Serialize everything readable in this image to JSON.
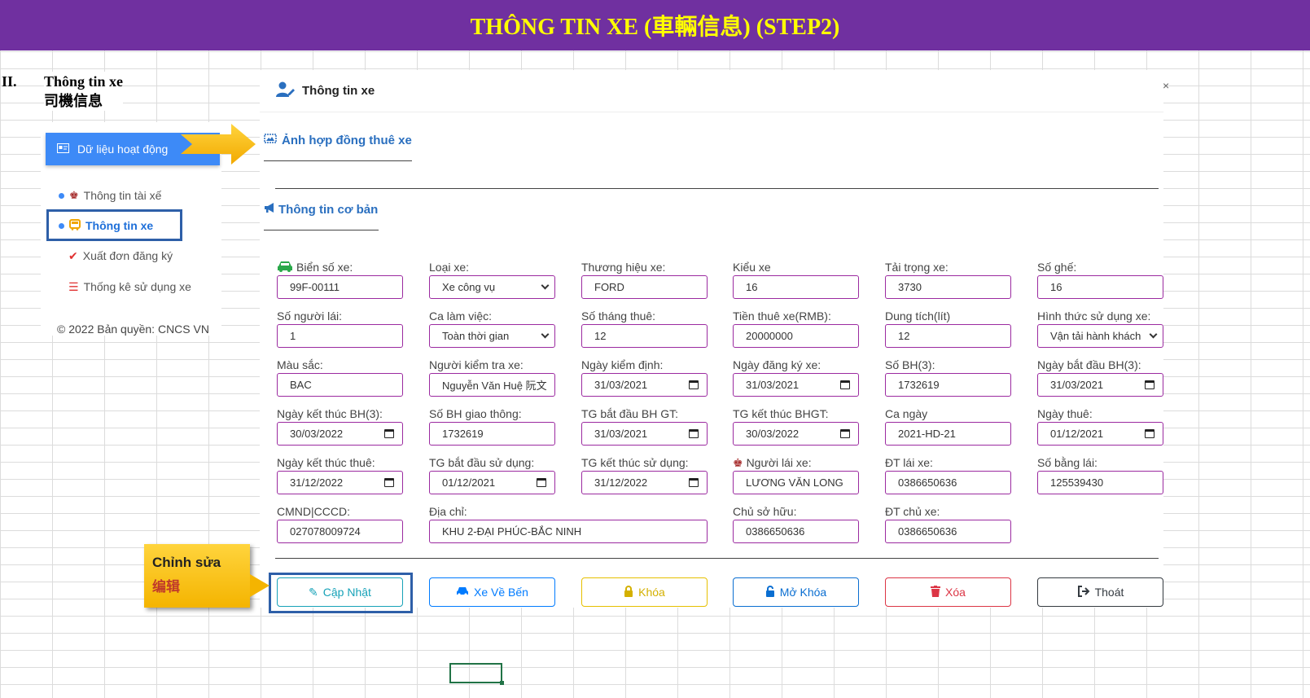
{
  "banner": {
    "title": "THÔNG TIN XE (車輛信息) (STEP2)"
  },
  "section": {
    "number": "II.",
    "title_vi": "Thông tin xe",
    "title_zh": "司機信息"
  },
  "sidebar": {
    "active_label": "Dữ liệu hoạt động",
    "items": [
      {
        "label": "Thông tin tài xế",
        "icon": "driver-icon",
        "active": false
      },
      {
        "label": "Thông tin xe",
        "icon": "bus-icon",
        "active": true
      },
      {
        "label": "Xuất đơn đăng ký",
        "icon": "check-icon",
        "active": false
      },
      {
        "label": "Thống kê sử dụng xe",
        "icon": "list-icon",
        "active": false
      }
    ],
    "copyright": "© 2022 Bản quyền: CNCS VN"
  },
  "modal": {
    "title": "Thông tin xe",
    "close": "×",
    "contract_link": "Ảnh hợp đồng thuê xe",
    "basic_info": "Thông tin cơ bản"
  },
  "fields": [
    {
      "label": "Biển số xe:",
      "value": "99F-00111",
      "type": "text"
    },
    {
      "label": "Loại xe:",
      "value": "Xe công vụ",
      "type": "select"
    },
    {
      "label": "Thương hiệu xe:",
      "value": "FORD",
      "type": "text"
    },
    {
      "label": "Kiểu xe",
      "value": "16",
      "type": "text"
    },
    {
      "label": "Tải trọng xe:",
      "value": "3730",
      "type": "text"
    },
    {
      "label": "Số ghế:",
      "value": "16",
      "type": "text"
    },
    {
      "label": "Số người lái:",
      "value": "1",
      "type": "text"
    },
    {
      "label": "Ca làm việc:",
      "value": "Toàn thời gian",
      "type": "select"
    },
    {
      "label": "Số tháng thuê:",
      "value": "12",
      "type": "text"
    },
    {
      "label": "Tiền thuê xe(RMB):",
      "value": "20000000",
      "type": "text"
    },
    {
      "label": "Dung tích(lít)",
      "value": "12",
      "type": "text"
    },
    {
      "label": "Hình thức sử dụng xe:",
      "value": "Vận tải hành khách",
      "type": "select"
    },
    {
      "label": "Màu sắc:",
      "value": "BAC",
      "type": "text"
    },
    {
      "label": "Người kiểm tra xe:",
      "value": "Nguyễn Văn Huệ 阮文",
      "type": "text"
    },
    {
      "label": "Ngày kiểm định:",
      "value": "31/03/2021",
      "type": "date"
    },
    {
      "label": "Ngày đăng ký xe:",
      "value": "31/03/2021",
      "type": "date"
    },
    {
      "label": "Số BH(3):",
      "value": "1732619",
      "type": "text"
    },
    {
      "label": "Ngày bắt đầu BH(3):",
      "value": "31/03/2021",
      "type": "date"
    },
    {
      "label": "Ngày kết thúc BH(3):",
      "value": "30/03/2022",
      "type": "date"
    },
    {
      "label": "Số BH giao thông:",
      "value": "1732619",
      "type": "text"
    },
    {
      "label": "TG bắt đầu BH GT:",
      "value": "31/03/2021",
      "type": "date"
    },
    {
      "label": "TG kết thúc BHGT:",
      "value": "30/03/2022",
      "type": "date"
    },
    {
      "label": "Ca ngày",
      "value": "2021-HD-21",
      "type": "text"
    },
    {
      "label": "Ngày thuê:",
      "value": "01/12/2021",
      "type": "date"
    },
    {
      "label": "Ngày kết thúc thuê:",
      "value": "31/12/2022",
      "type": "date"
    },
    {
      "label": "TG bắt đầu sử dụng:",
      "value": "01/12/2021",
      "type": "date"
    },
    {
      "label": "TG kết thúc sử dụng:",
      "value": "31/12/2022",
      "type": "date"
    },
    {
      "label": "Người lái xe:",
      "value": "LƯƠNG VĂN LONG",
      "type": "text"
    },
    {
      "label": "ĐT lái xe:",
      "value": "0386650636",
      "type": "text"
    },
    {
      "label": "Số bằng lái:",
      "value": "125539430",
      "type": "text"
    },
    {
      "label": "CMND|CCCD:",
      "value": "027078009724",
      "type": "text"
    },
    {
      "label": "Địa chỉ:",
      "value": "KHU 2-ĐẠI PHÚC-BẮC NINH",
      "type": "text"
    },
    {
      "label": "Chủ sở hữu:",
      "value": "0386650636",
      "type": "text"
    },
    {
      "label": "ĐT chủ xe:",
      "value": "0386650636",
      "type": "text"
    }
  ],
  "buttons": [
    {
      "label": "Cập Nhật",
      "icon": "pencil-icon",
      "color": "#17a2b8"
    },
    {
      "label": "Xe Về Bến",
      "icon": "car-icon",
      "color": "#007bff"
    },
    {
      "label": "Khóa",
      "icon": "lock-icon",
      "color": "#e6c000"
    },
    {
      "label": "Mở Khóa",
      "icon": "unlock-icon",
      "color": "#0a6ed1"
    },
    {
      "label": "Xóa",
      "icon": "trash-icon",
      "color": "#dc3545"
    },
    {
      "label": "Thoát",
      "icon": "sign-out-icon",
      "color": "#343a40"
    }
  ],
  "callout": {
    "line1": "Chỉnh sửa",
    "line2": "编辑"
  },
  "colors": {
    "banner": "#7030a0",
    "banner_text": "#ffff00",
    "accent": "#3d8af7",
    "field_border": "#9b2aa0"
  }
}
